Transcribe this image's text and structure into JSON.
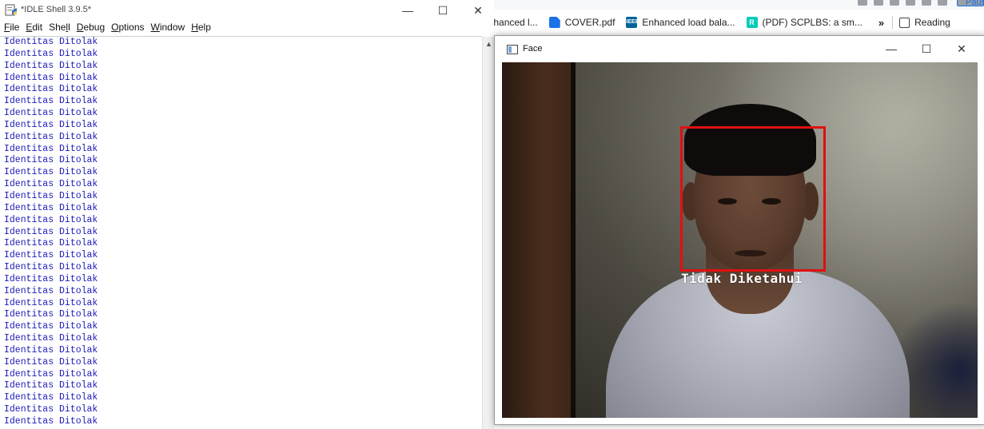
{
  "browser": {
    "bookmarks": [
      {
        "label": "enhanced l...",
        "icon": "none"
      },
      {
        "label": "COVER.pdf",
        "icon": "document-icon"
      },
      {
        "label": "Enhanced load bala...",
        "icon": "ieee-icon"
      },
      {
        "label": "(PDF) SCPLBS: a sm...",
        "icon": "researchgate-icon"
      }
    ],
    "more": "»",
    "reading_label": "Reading",
    "paused_label": "Paused",
    "edge_text": "ex"
  },
  "idle": {
    "title": "*IDLE Shell 3.9.5*",
    "menu": [
      "File",
      "Edit",
      "Shell",
      "Debug",
      "Options",
      "Window",
      "Help"
    ],
    "menu_underline": [
      "F",
      "E",
      "l",
      "D",
      "O",
      "W",
      "H"
    ],
    "output_lines": [
      "Identitas Ditolak",
      "Identitas Ditolak",
      "Identitas Ditolak",
      "Identitas Ditolak",
      "Identitas Ditolak",
      "Identitas Ditolak",
      "Identitas Ditolak",
      "Identitas Ditolak",
      "Identitas Ditolak",
      "Identitas Ditolak",
      "Identitas Ditolak",
      "Identitas Ditolak",
      "Identitas Ditolak",
      "Identitas Ditolak",
      "Identitas Ditolak",
      "Identitas Ditolak",
      "Identitas Ditolak",
      "Identitas Ditolak",
      "Identitas Ditolak",
      "Identitas Ditolak",
      "Identitas Ditolak",
      "Identitas Ditolak",
      "Identitas Ditolak",
      "Identitas Ditolak",
      "Identitas Ditolak",
      "Identitas Ditolak",
      "Identitas Ditolak",
      "Identitas Ditolak",
      "Identitas Ditolak",
      "Identitas Ditolak",
      "Identitas Ditolak",
      "Identitas Ditolak",
      "Identitas Ditolak"
    ],
    "output_color": "#1c19b8"
  },
  "face_window": {
    "title": "Face",
    "detection_label": "Tidak Diketahui",
    "box_color": "#e01010"
  },
  "window_controls": {
    "minimize": "—",
    "maximize": "☐",
    "close": "✕"
  }
}
